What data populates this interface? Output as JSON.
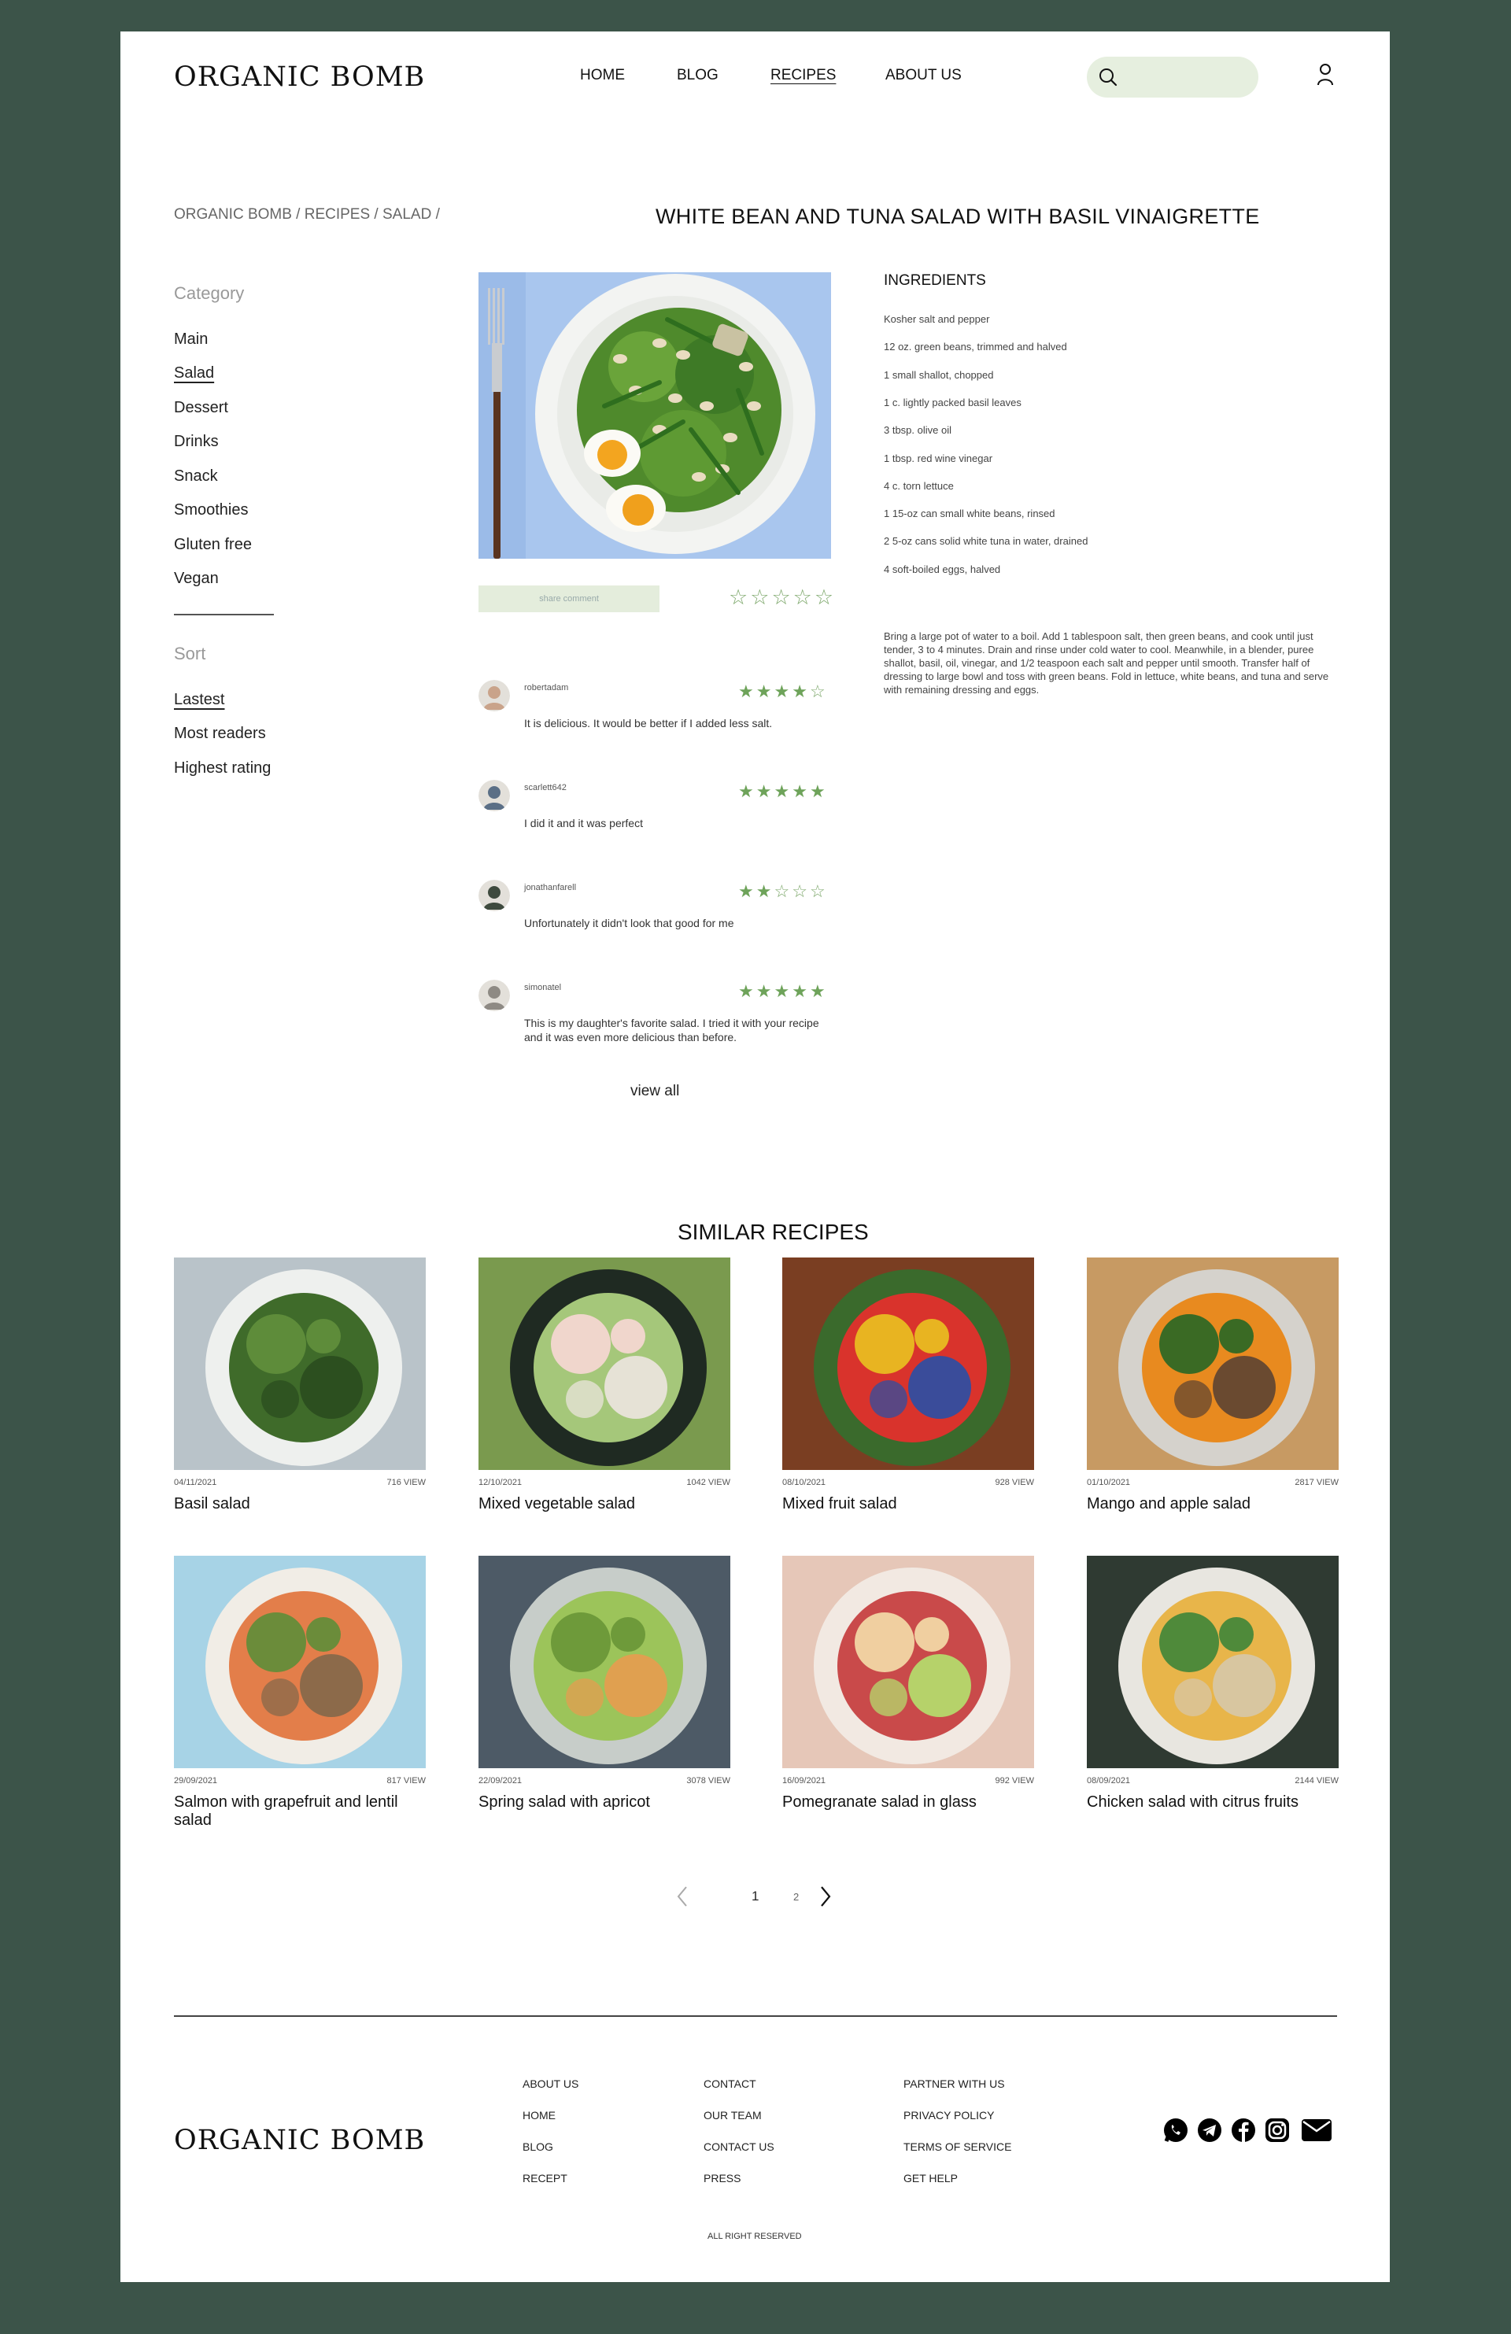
{
  "brand": "ORGANIC BOMB",
  "nav": [
    {
      "label": "HOME",
      "active": false
    },
    {
      "label": "BLOG",
      "active": false
    },
    {
      "label": "RECIPES",
      "active": true
    },
    {
      "label": "ABOUT US",
      "active": false
    }
  ],
  "search": {
    "placeholder": "",
    "value": ""
  },
  "breadcrumb": "ORGANIC BOMB / RECIPES / SALAD /",
  "recipe": {
    "title": "WHITE BEAN AND TUNA SALAD WITH BASIL VINAIGRETTE"
  },
  "sidebar": {
    "category_heading": "Category",
    "categories": [
      {
        "label": "Main",
        "active": false
      },
      {
        "label": "Salad",
        "active": true
      },
      {
        "label": "Dessert",
        "active": false
      },
      {
        "label": "Drinks",
        "active": false
      },
      {
        "label": "Snack",
        "active": false
      },
      {
        "label": "Smoothies",
        "active": false
      },
      {
        "label": "Gluten free",
        "active": false
      },
      {
        "label": "Vegan",
        "active": false
      }
    ],
    "sort_heading": "Sort",
    "sort_options": [
      {
        "label": "Lastest",
        "active": true
      },
      {
        "label": "Most readers",
        "active": false
      },
      {
        "label": "Highest rating",
        "active": false
      }
    ]
  },
  "share_comment": "share comment",
  "user_rating": 0,
  "comments": [
    {
      "user": "robertadam",
      "rating": 4,
      "text": "It is delicious. It would be better if I added less salt.",
      "avatar_color": "#c9a38a"
    },
    {
      "user": "scarlett642",
      "rating": 5,
      "text": "I did it and it was perfect",
      "avatar_color": "#5b6f86"
    },
    {
      "user": "jonathanfarell",
      "rating": 2,
      "text": "Unfortunately it didn't look that good for me",
      "avatar_color": "#3e4a3e"
    },
    {
      "user": "simonatel",
      "rating": 5,
      "text": "This is my daughter's favorite salad. I tried it with your recipe and it was even more delicious than before.",
      "avatar_color": "#8e8a84"
    }
  ],
  "view_all": "view all",
  "ingredients": {
    "heading": "INGREDIENTS",
    "items": [
      "Kosher salt and pepper",
      "12 oz. green beans, trimmed and halved",
      "1 small shallot, chopped",
      "1 c. lightly packed basil leaves",
      "3 tbsp. olive oil",
      "1 tbsp. red wine vinegar",
      "4 c. torn lettuce",
      "1 15-oz can small white beans, rinsed",
      "2 5-oz cans solid white tuna in water, drained",
      "4 soft-boiled eggs, halved"
    ]
  },
  "directions": "Bring a large pot of water to a boil. Add 1 tablespoon salt, then green beans, and cook until just tender, 3 to 4 minutes. Drain and rinse under cold water to cool.  Meanwhile, in a blender, puree shallot, basil, oil, vinegar, and 1/2 teaspoon each salt and pepper until smooth.  Transfer half of dressing to large bowl and toss with green beans. Fold in lettuce, white beans, and tuna and serve with remaining dressing and eggs.",
  "similar": {
    "heading": "SIMILAR RECIPES",
    "cards": [
      {
        "date": "04/11/2021",
        "views": "716 VIEW",
        "title": "Basil salad",
        "bg": "#b9c3c9",
        "plate": "#eef0ee",
        "food": [
          "#3f6b2a",
          "#5e8c3a",
          "#2c4f1f"
        ]
      },
      {
        "date": "12/10/2021",
        "views": "1042 VIEW",
        "title": "Mixed vegetable salad",
        "bg": "#7a9a4e",
        "plate": "#1f2a22",
        "food": [
          "#a5c77a",
          "#f0d6cc",
          "#e6e2d6"
        ]
      },
      {
        "date": "08/10/2021",
        "views": "928 VIEW",
        "title": "Mixed fruit salad",
        "bg": "#7a3e22",
        "plate": "#3a6a2c",
        "food": [
          "#d9332c",
          "#e8b421",
          "#3a4c9a"
        ]
      },
      {
        "date": "01/10/2021",
        "views": "2817 VIEW",
        "title": "Mango and apple salad",
        "bg": "#c79a63",
        "plate": "#d5d2cc",
        "food": [
          "#e88a1f",
          "#3a6a24",
          "#6a4a30"
        ]
      },
      {
        "date": "29/09/2021",
        "views": "817 VIEW",
        "title": "Salmon with grapefruit and lentil salad",
        "bg": "#a7d3e6",
        "plate": "#f1ede6",
        "food": [
          "#e37e4a",
          "#6b8c3a",
          "#8c6a4a"
        ]
      },
      {
        "date": "22/09/2021",
        "views": "3078 VIEW",
        "title": "Spring salad with apricot",
        "bg": "#4d5a66",
        "plate": "#c7cdc9",
        "food": [
          "#9cc45a",
          "#6e9a3a",
          "#e0a050"
        ]
      },
      {
        "date": "16/09/2021",
        "views": "992 VIEW",
        "title": "Pomegranate salad in glass",
        "bg": "#e6c7b8",
        "plate": "#f2e9e2",
        "food": [
          "#c94a4a",
          "#f0cfa0",
          "#b6d26a"
        ]
      },
      {
        "date": "08/09/2021",
        "views": "2144 VIEW",
        "title": "Chicken salad with citrus fruits",
        "bg": "#2f3a32",
        "plate": "#e8e6e0",
        "food": [
          "#e8b54a",
          "#4f8a3a",
          "#d8c6a0"
        ]
      }
    ]
  },
  "pagination": {
    "pages": [
      "1",
      "2"
    ],
    "current": "1"
  },
  "footer": {
    "col1": [
      "ABOUT US",
      "HOME",
      "BLOG",
      "RECEPT"
    ],
    "col2": [
      "CONTACT",
      "OUR TEAM",
      "CONTACT US",
      "PRESS"
    ],
    "col3": [
      "PARTNER WITH US",
      "PRIVACY POLICY",
      "TERMS OF SERVICE",
      "GET HELP"
    ],
    "social": [
      "whatsapp-icon",
      "telegram-icon",
      "facebook-icon",
      "instagram-icon",
      "mail-icon"
    ],
    "copyright": "ALL RIGHT RESERVED"
  },
  "colors": {
    "page_bg": "#3c5449",
    "accent_green": "#6ea35a",
    "search_bg": "#e6efdf"
  }
}
